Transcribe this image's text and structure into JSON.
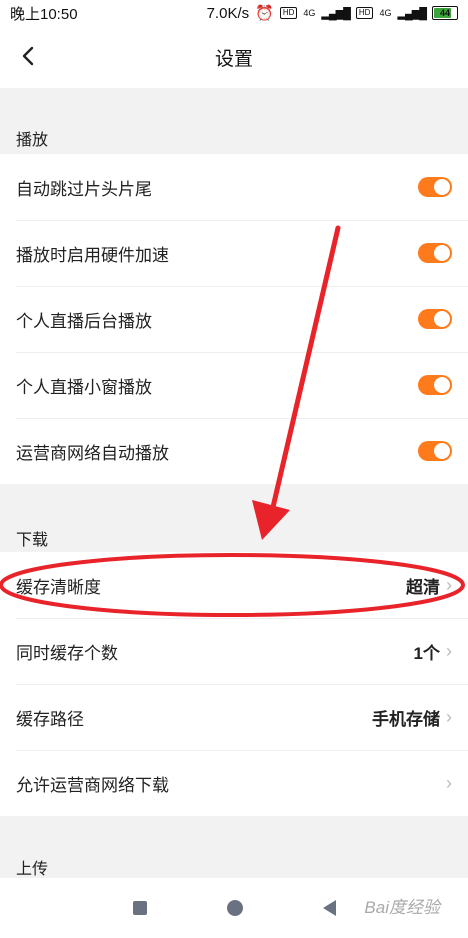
{
  "status_bar": {
    "time": "晚上10:50",
    "speed": "7.0K/s",
    "hd1": "HD",
    "net1": "4G",
    "hd2": "HD",
    "net2": "4G",
    "battery": "44"
  },
  "header": {
    "title": "设置"
  },
  "sections": {
    "playback": {
      "title": "播放",
      "items": [
        {
          "label": "自动跳过片头片尾",
          "toggle": true
        },
        {
          "label": "播放时启用硬件加速",
          "toggle": true
        },
        {
          "label": "个人直播后台播放",
          "toggle": true
        },
        {
          "label": "个人直播小窗播放",
          "toggle": true
        },
        {
          "label": "运营商网络自动播放",
          "toggle": true
        }
      ]
    },
    "download": {
      "title": "下载",
      "items": [
        {
          "label": "缓存清晰度",
          "value": "超清"
        },
        {
          "label": "同时缓存个数",
          "value": "1个"
        },
        {
          "label": "缓存路径",
          "value": "手机存储"
        },
        {
          "label": "允许运营商网络下载",
          "value": ""
        }
      ]
    },
    "upload": {
      "title": "上传"
    }
  },
  "watermark": "Bai度经验",
  "colors": {
    "accent": "#ff7a1a",
    "annotation_red": "#e8232a"
  }
}
